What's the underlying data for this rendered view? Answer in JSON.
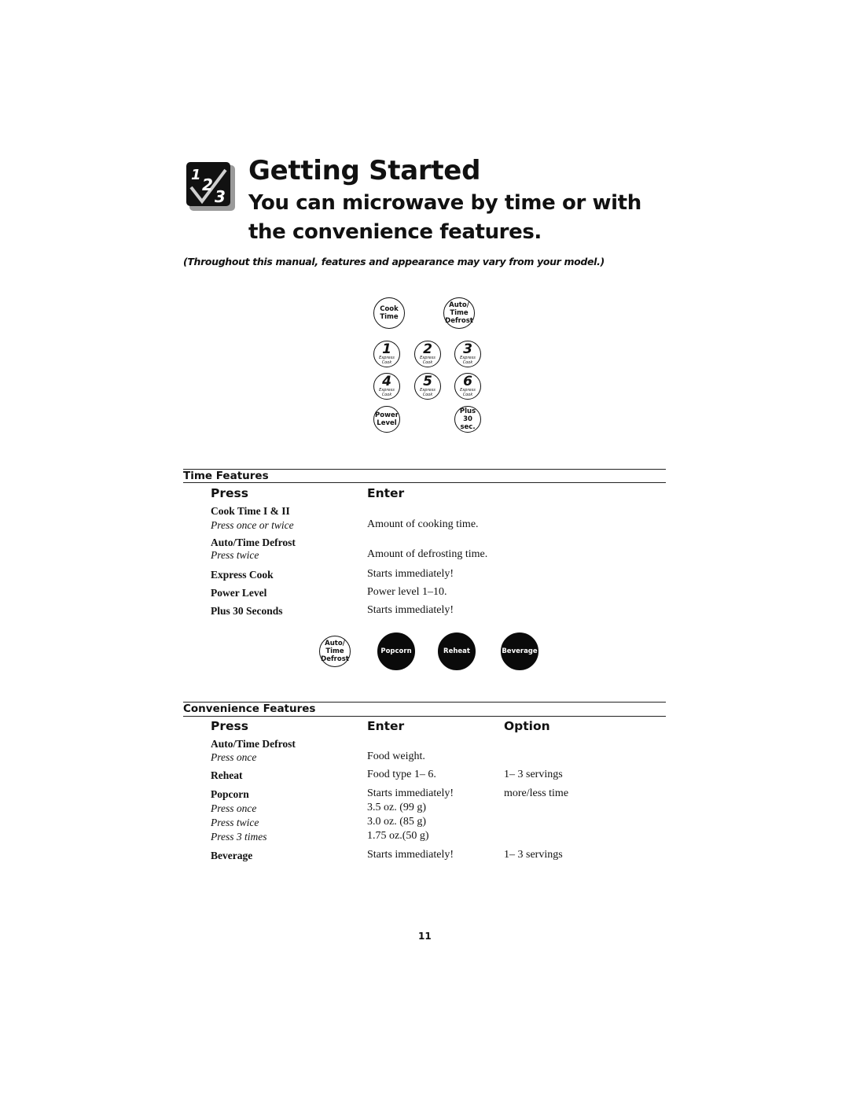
{
  "header": {
    "logo_icon": "one-two-three-checkmark-icon",
    "logo_glyphs": [
      "1",
      "2",
      "3"
    ],
    "title": "Getting Started",
    "subtitle": "You can microwave by time or with the convenience features.",
    "note": "(Throughout this manual, features and appearance may vary from your model.)"
  },
  "keypad": {
    "top_row": [
      {
        "label_lines": [
          "Cook",
          "Time"
        ]
      },
      {
        "label_lines": [
          "Auto/",
          "Time",
          "Defrost"
        ]
      }
    ],
    "number_keys": [
      {
        "num": "1",
        "sub": [
          "Express",
          "Cook"
        ]
      },
      {
        "num": "2",
        "sub": [
          "Express",
          "Cook"
        ]
      },
      {
        "num": "3",
        "sub": [
          "Express",
          "Cook"
        ]
      },
      {
        "num": "4",
        "sub": [
          "Express",
          "Cook"
        ]
      },
      {
        "num": "5",
        "sub": [
          "Express",
          "Cook"
        ]
      },
      {
        "num": "6",
        "sub": [
          "Express",
          "Cook"
        ]
      }
    ],
    "bottom_row": [
      {
        "label_lines": [
          "Power",
          "Level"
        ]
      },
      {
        "label_lines": [
          "Plus",
          "30 sec."
        ]
      }
    ]
  },
  "time_features": {
    "section_title": "Time Features",
    "columns": {
      "press": "Press",
      "enter": "Enter"
    },
    "rows": [
      {
        "press": "Cook Time I & II",
        "press_note": "Press once or twice",
        "enter": "Amount of cooking time."
      },
      {
        "press": "Auto/Time Defrost",
        "press_note": "Press twice",
        "enter": "Amount of defrosting time."
      },
      {
        "press": "Express Cook",
        "enter": "Starts immediately!"
      },
      {
        "press": "Power Level",
        "enter": "Power level 1–10."
      },
      {
        "press": "Plus 30 Seconds",
        "enter": "Starts immediately!"
      }
    ]
  },
  "convenience_buttons": [
    {
      "label_lines": [
        "Auto/",
        "Time",
        "Defrost"
      ],
      "style": "outline"
    },
    {
      "label_lines": [
        "Popcorn"
      ],
      "style": "filled"
    },
    {
      "label_lines": [
        "Reheat"
      ],
      "style": "filled"
    },
    {
      "label_lines": [
        "Beverage"
      ],
      "style": "filled"
    }
  ],
  "convenience_features": {
    "section_title": "Convenience Features",
    "columns": {
      "press": "Press",
      "enter": "Enter",
      "option": "Option"
    },
    "rows": [
      {
        "press": "Auto/Time Defrost",
        "press_note": "Press once",
        "enter": "Food weight.",
        "option": ""
      },
      {
        "press": "Reheat",
        "enter": "Food type 1– 6.",
        "option": "1– 3 servings"
      },
      {
        "press": "Popcorn",
        "enter": "Starts immediately!",
        "option": "more/less time"
      },
      {
        "press_note": "Press once",
        "enter": "3.5 oz.  (99 g)"
      },
      {
        "press_note": "Press twice",
        "enter": "3.0 oz.  (85 g)"
      },
      {
        "press_note": "Press 3 times",
        "enter": "1.75 oz.(50 g)"
      },
      {
        "press": "Beverage",
        "enter": "Starts immediately!",
        "option": "1– 3 servings"
      }
    ]
  },
  "footer": {
    "page_number": "11"
  }
}
